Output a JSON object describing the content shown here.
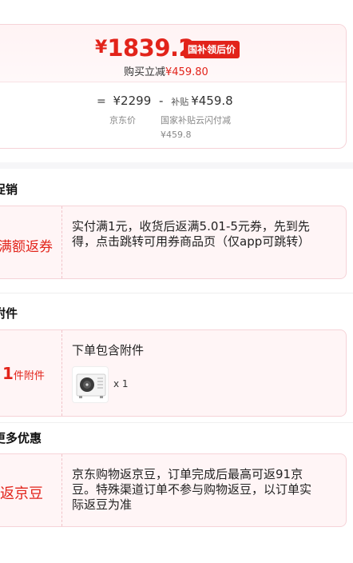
{
  "price": {
    "currency": "¥",
    "final_price": "1839.2",
    "badge": "国补领后价",
    "save_prefix": "购买立减",
    "save_amount": "¥459.80",
    "formula": {
      "eq": "=",
      "jd_price": "¥2299",
      "minus": "-",
      "subsidy_prefix": "补贴",
      "subsidy_amount": "¥459.8"
    },
    "jd_label": "京东价",
    "gov_label": "国家补贴云闪付减",
    "gov_amount": "¥459.8"
  },
  "sections": {
    "promo": {
      "title": "促销",
      "left_label": "满额返券",
      "desc": "实付满1元，收货后返满5.01-5元券，先到先得，点击跳转可用券商品页（仅app可跳转）"
    },
    "accessory": {
      "title": "附件",
      "count": "1",
      "unit": "件附件",
      "desc": "下单包含附件",
      "qty": "x 1",
      "thumb_icon": "air-conditioner-outdoor-unit"
    },
    "more": {
      "title": "更多优惠",
      "left_label": "返京豆",
      "desc": "京东购物返京豆，订单完成后最高可返91京豆。特殊渠道订单不参与购物返豆，以订单实际返豆为准"
    }
  },
  "colors": {
    "accent": "#e2231a",
    "card_bg": "#fff5f6",
    "card_border": "#f6d3d8"
  }
}
